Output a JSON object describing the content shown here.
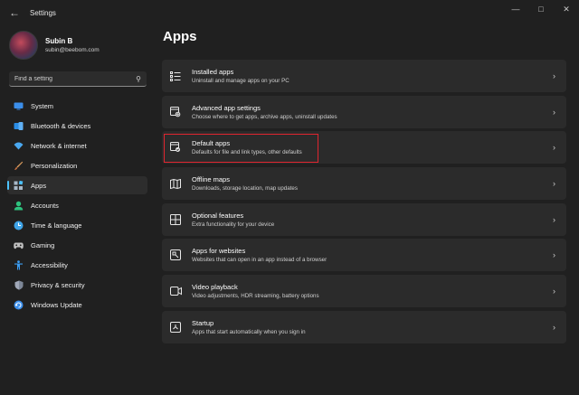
{
  "window": {
    "title": "Settings"
  },
  "profile": {
    "name": "Subin B",
    "email": "subin@beebom.com"
  },
  "search": {
    "placeholder": "Find a setting"
  },
  "nav": [
    {
      "label": "System",
      "icon": "monitor-icon",
      "color": "#3b8eea"
    },
    {
      "label": "Bluetooth & devices",
      "icon": "bluetooth-icon",
      "color": "#2b8de6"
    },
    {
      "label": "Network & internet",
      "icon": "wifi-icon",
      "color": "#4aa8f0"
    },
    {
      "label": "Personalization",
      "icon": "brush-icon",
      "color": "#e0a060"
    },
    {
      "label": "Apps",
      "icon": "apps-icon",
      "color": "#a8b8c8",
      "active": true
    },
    {
      "label": "Accounts",
      "icon": "person-icon",
      "color": "#2ec27e"
    },
    {
      "label": "Time & language",
      "icon": "globe-clock-icon",
      "color": "#3fa4e8"
    },
    {
      "label": "Gaming",
      "icon": "gamepad-icon",
      "color": "#c0c0c0"
    },
    {
      "label": "Accessibility",
      "icon": "accessibility-icon",
      "color": "#3b9cf0"
    },
    {
      "label": "Privacy & security",
      "icon": "shield-icon",
      "color": "#a0a8b8"
    },
    {
      "label": "Windows Update",
      "icon": "update-icon",
      "color": "#3b8eea"
    }
  ],
  "main": {
    "title": "Apps",
    "items": [
      {
        "title": "Installed apps",
        "subtitle": "Uninstall and manage apps on your PC",
        "icon": "list-icon"
      },
      {
        "title": "Advanced app settings",
        "subtitle": "Choose where to get apps, archive apps, uninstall updates",
        "icon": "app-settings-icon"
      },
      {
        "title": "Default apps",
        "subtitle": "Defaults for file and link types, other defaults",
        "icon": "default-apps-icon"
      },
      {
        "title": "Offline maps",
        "subtitle": "Downloads, storage location, map updates",
        "icon": "map-icon"
      },
      {
        "title": "Optional features",
        "subtitle": "Extra functionality for your device",
        "icon": "features-icon"
      },
      {
        "title": "Apps for websites",
        "subtitle": "Websites that can open in an app instead of a browser",
        "icon": "web-app-icon"
      },
      {
        "title": "Video playback",
        "subtitle": "Video adjustments, HDR streaming, battery options",
        "icon": "video-icon"
      },
      {
        "title": "Startup",
        "subtitle": "Apps that start automatically when you sign in",
        "icon": "startup-icon"
      }
    ]
  },
  "colors": {
    "accent": "#4cc2ff",
    "highlight": "#e0252f",
    "background": "#202020",
    "card": "#2b2b2b"
  }
}
